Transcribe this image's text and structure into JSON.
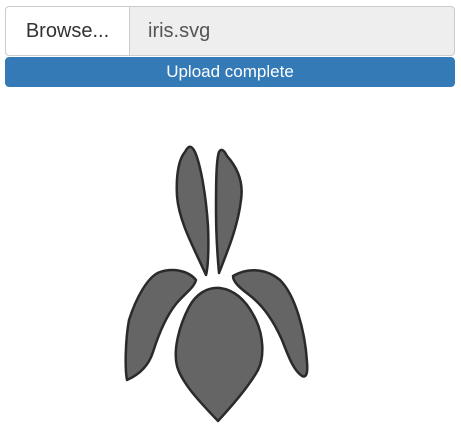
{
  "file_input": {
    "browse_label": "Browse...",
    "filename": "iris.svg"
  },
  "progress": {
    "label": "Upload complete",
    "fraction": 1.0,
    "color": "#337ab7"
  },
  "preview": {
    "fill_color": "#656565",
    "stroke_color": "#2a2a2a"
  }
}
